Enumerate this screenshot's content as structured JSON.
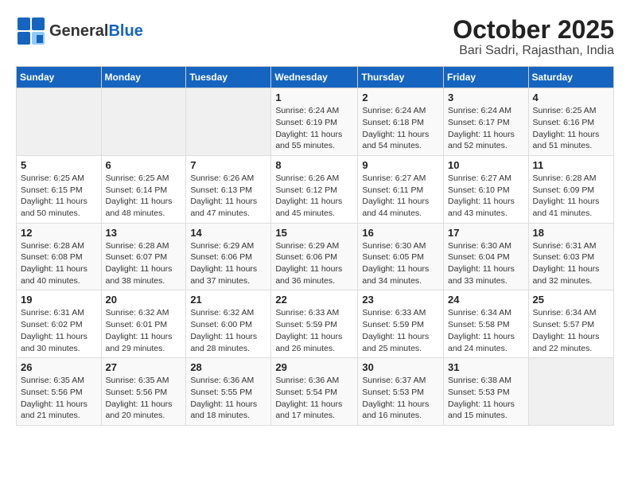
{
  "header": {
    "logo_general": "General",
    "logo_blue": "Blue",
    "title": "October 2025",
    "subtitle": "Bari Sadri, Rajasthan, India"
  },
  "calendar": {
    "days_of_week": [
      "Sunday",
      "Monday",
      "Tuesday",
      "Wednesday",
      "Thursday",
      "Friday",
      "Saturday"
    ],
    "weeks": [
      [
        {
          "day": "",
          "info": ""
        },
        {
          "day": "",
          "info": ""
        },
        {
          "day": "",
          "info": ""
        },
        {
          "day": "1",
          "info": "Sunrise: 6:24 AM\nSunset: 6:19 PM\nDaylight: 11 hours and 55 minutes."
        },
        {
          "day": "2",
          "info": "Sunrise: 6:24 AM\nSunset: 6:18 PM\nDaylight: 11 hours and 54 minutes."
        },
        {
          "day": "3",
          "info": "Sunrise: 6:24 AM\nSunset: 6:17 PM\nDaylight: 11 hours and 52 minutes."
        },
        {
          "day": "4",
          "info": "Sunrise: 6:25 AM\nSunset: 6:16 PM\nDaylight: 11 hours and 51 minutes."
        }
      ],
      [
        {
          "day": "5",
          "info": "Sunrise: 6:25 AM\nSunset: 6:15 PM\nDaylight: 11 hours and 50 minutes."
        },
        {
          "day": "6",
          "info": "Sunrise: 6:25 AM\nSunset: 6:14 PM\nDaylight: 11 hours and 48 minutes."
        },
        {
          "day": "7",
          "info": "Sunrise: 6:26 AM\nSunset: 6:13 PM\nDaylight: 11 hours and 47 minutes."
        },
        {
          "day": "8",
          "info": "Sunrise: 6:26 AM\nSunset: 6:12 PM\nDaylight: 11 hours and 45 minutes."
        },
        {
          "day": "9",
          "info": "Sunrise: 6:27 AM\nSunset: 6:11 PM\nDaylight: 11 hours and 44 minutes."
        },
        {
          "day": "10",
          "info": "Sunrise: 6:27 AM\nSunset: 6:10 PM\nDaylight: 11 hours and 43 minutes."
        },
        {
          "day": "11",
          "info": "Sunrise: 6:28 AM\nSunset: 6:09 PM\nDaylight: 11 hours and 41 minutes."
        }
      ],
      [
        {
          "day": "12",
          "info": "Sunrise: 6:28 AM\nSunset: 6:08 PM\nDaylight: 11 hours and 40 minutes."
        },
        {
          "day": "13",
          "info": "Sunrise: 6:28 AM\nSunset: 6:07 PM\nDaylight: 11 hours and 38 minutes."
        },
        {
          "day": "14",
          "info": "Sunrise: 6:29 AM\nSunset: 6:06 PM\nDaylight: 11 hours and 37 minutes."
        },
        {
          "day": "15",
          "info": "Sunrise: 6:29 AM\nSunset: 6:06 PM\nDaylight: 11 hours and 36 minutes."
        },
        {
          "day": "16",
          "info": "Sunrise: 6:30 AM\nSunset: 6:05 PM\nDaylight: 11 hours and 34 minutes."
        },
        {
          "day": "17",
          "info": "Sunrise: 6:30 AM\nSunset: 6:04 PM\nDaylight: 11 hours and 33 minutes."
        },
        {
          "day": "18",
          "info": "Sunrise: 6:31 AM\nSunset: 6:03 PM\nDaylight: 11 hours and 32 minutes."
        }
      ],
      [
        {
          "day": "19",
          "info": "Sunrise: 6:31 AM\nSunset: 6:02 PM\nDaylight: 11 hours and 30 minutes."
        },
        {
          "day": "20",
          "info": "Sunrise: 6:32 AM\nSunset: 6:01 PM\nDaylight: 11 hours and 29 minutes."
        },
        {
          "day": "21",
          "info": "Sunrise: 6:32 AM\nSunset: 6:00 PM\nDaylight: 11 hours and 28 minutes."
        },
        {
          "day": "22",
          "info": "Sunrise: 6:33 AM\nSunset: 5:59 PM\nDaylight: 11 hours and 26 minutes."
        },
        {
          "day": "23",
          "info": "Sunrise: 6:33 AM\nSunset: 5:59 PM\nDaylight: 11 hours and 25 minutes."
        },
        {
          "day": "24",
          "info": "Sunrise: 6:34 AM\nSunset: 5:58 PM\nDaylight: 11 hours and 24 minutes."
        },
        {
          "day": "25",
          "info": "Sunrise: 6:34 AM\nSunset: 5:57 PM\nDaylight: 11 hours and 22 minutes."
        }
      ],
      [
        {
          "day": "26",
          "info": "Sunrise: 6:35 AM\nSunset: 5:56 PM\nDaylight: 11 hours and 21 minutes."
        },
        {
          "day": "27",
          "info": "Sunrise: 6:35 AM\nSunset: 5:56 PM\nDaylight: 11 hours and 20 minutes."
        },
        {
          "day": "28",
          "info": "Sunrise: 6:36 AM\nSunset: 5:55 PM\nDaylight: 11 hours and 18 minutes."
        },
        {
          "day": "29",
          "info": "Sunrise: 6:36 AM\nSunset: 5:54 PM\nDaylight: 11 hours and 17 minutes."
        },
        {
          "day": "30",
          "info": "Sunrise: 6:37 AM\nSunset: 5:53 PM\nDaylight: 11 hours and 16 minutes."
        },
        {
          "day": "31",
          "info": "Sunrise: 6:38 AM\nSunset: 5:53 PM\nDaylight: 11 hours and 15 minutes."
        },
        {
          "day": "",
          "info": ""
        }
      ]
    ]
  }
}
